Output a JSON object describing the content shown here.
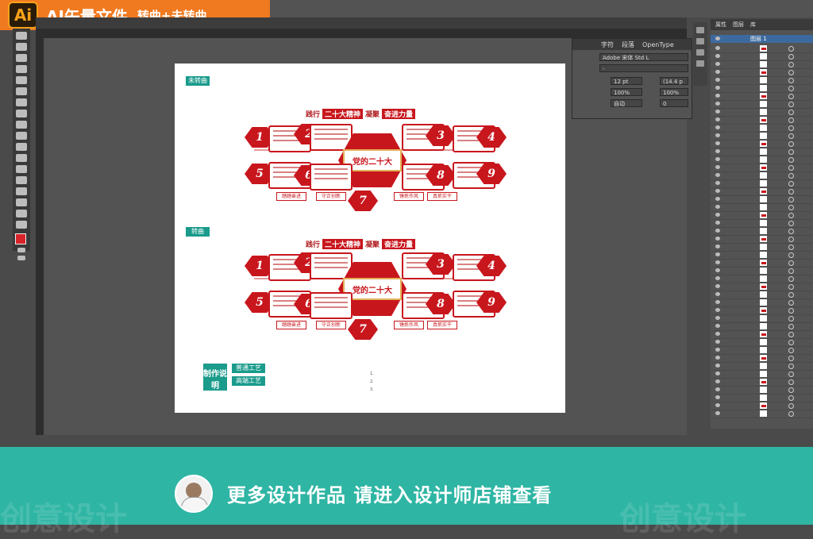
{
  "header": {
    "logo": "Ai",
    "title": "AI矢量文件",
    "subtitle": "转曲+未转曲"
  },
  "artboard": {
    "section_unconverted": "未转曲",
    "section_converted": "转曲",
    "banner": {
      "prefix": "践行",
      "highlight1": "二十大精神",
      "middle": "凝聚",
      "highlight2": "奋进力量"
    },
    "center_label": "党的二十大",
    "numbers": [
      "1",
      "2",
      "3",
      "4",
      "5",
      "6",
      "7",
      "8",
      "9"
    ],
    "buttons": [
      "踏踏奋进",
      "守正创新",
      "锤炼作风",
      "真抓实干"
    ],
    "production": {
      "label": "制作说明",
      "craft_normal": "普通工艺",
      "craft_high": "高端工艺"
    },
    "notes": [
      "1.",
      "2.",
      "3."
    ]
  },
  "char_panel": {
    "tabs": [
      "字符",
      "段落",
      "OpenType"
    ],
    "font_name": "Adobe 宋体 Std L",
    "font_style": "-",
    "font_size": "12 pt",
    "leading": "(14.4 p",
    "h_scale": "100%",
    "v_scale": "100%",
    "kerning": "自动",
    "tracking": "0"
  },
  "layers_panel": {
    "tabs": [
      "属性",
      "图层",
      "库"
    ],
    "layer_name": "图层 1"
  },
  "footer": {
    "cta": "更多设计作品 请进入设计师店铺查看",
    "watermark_left": "创意设计",
    "watermark_right": "创意设计"
  },
  "colors": {
    "brand_orange": "#f07a20",
    "party_red": "#c8161d",
    "teal": "#2fb5a4"
  }
}
